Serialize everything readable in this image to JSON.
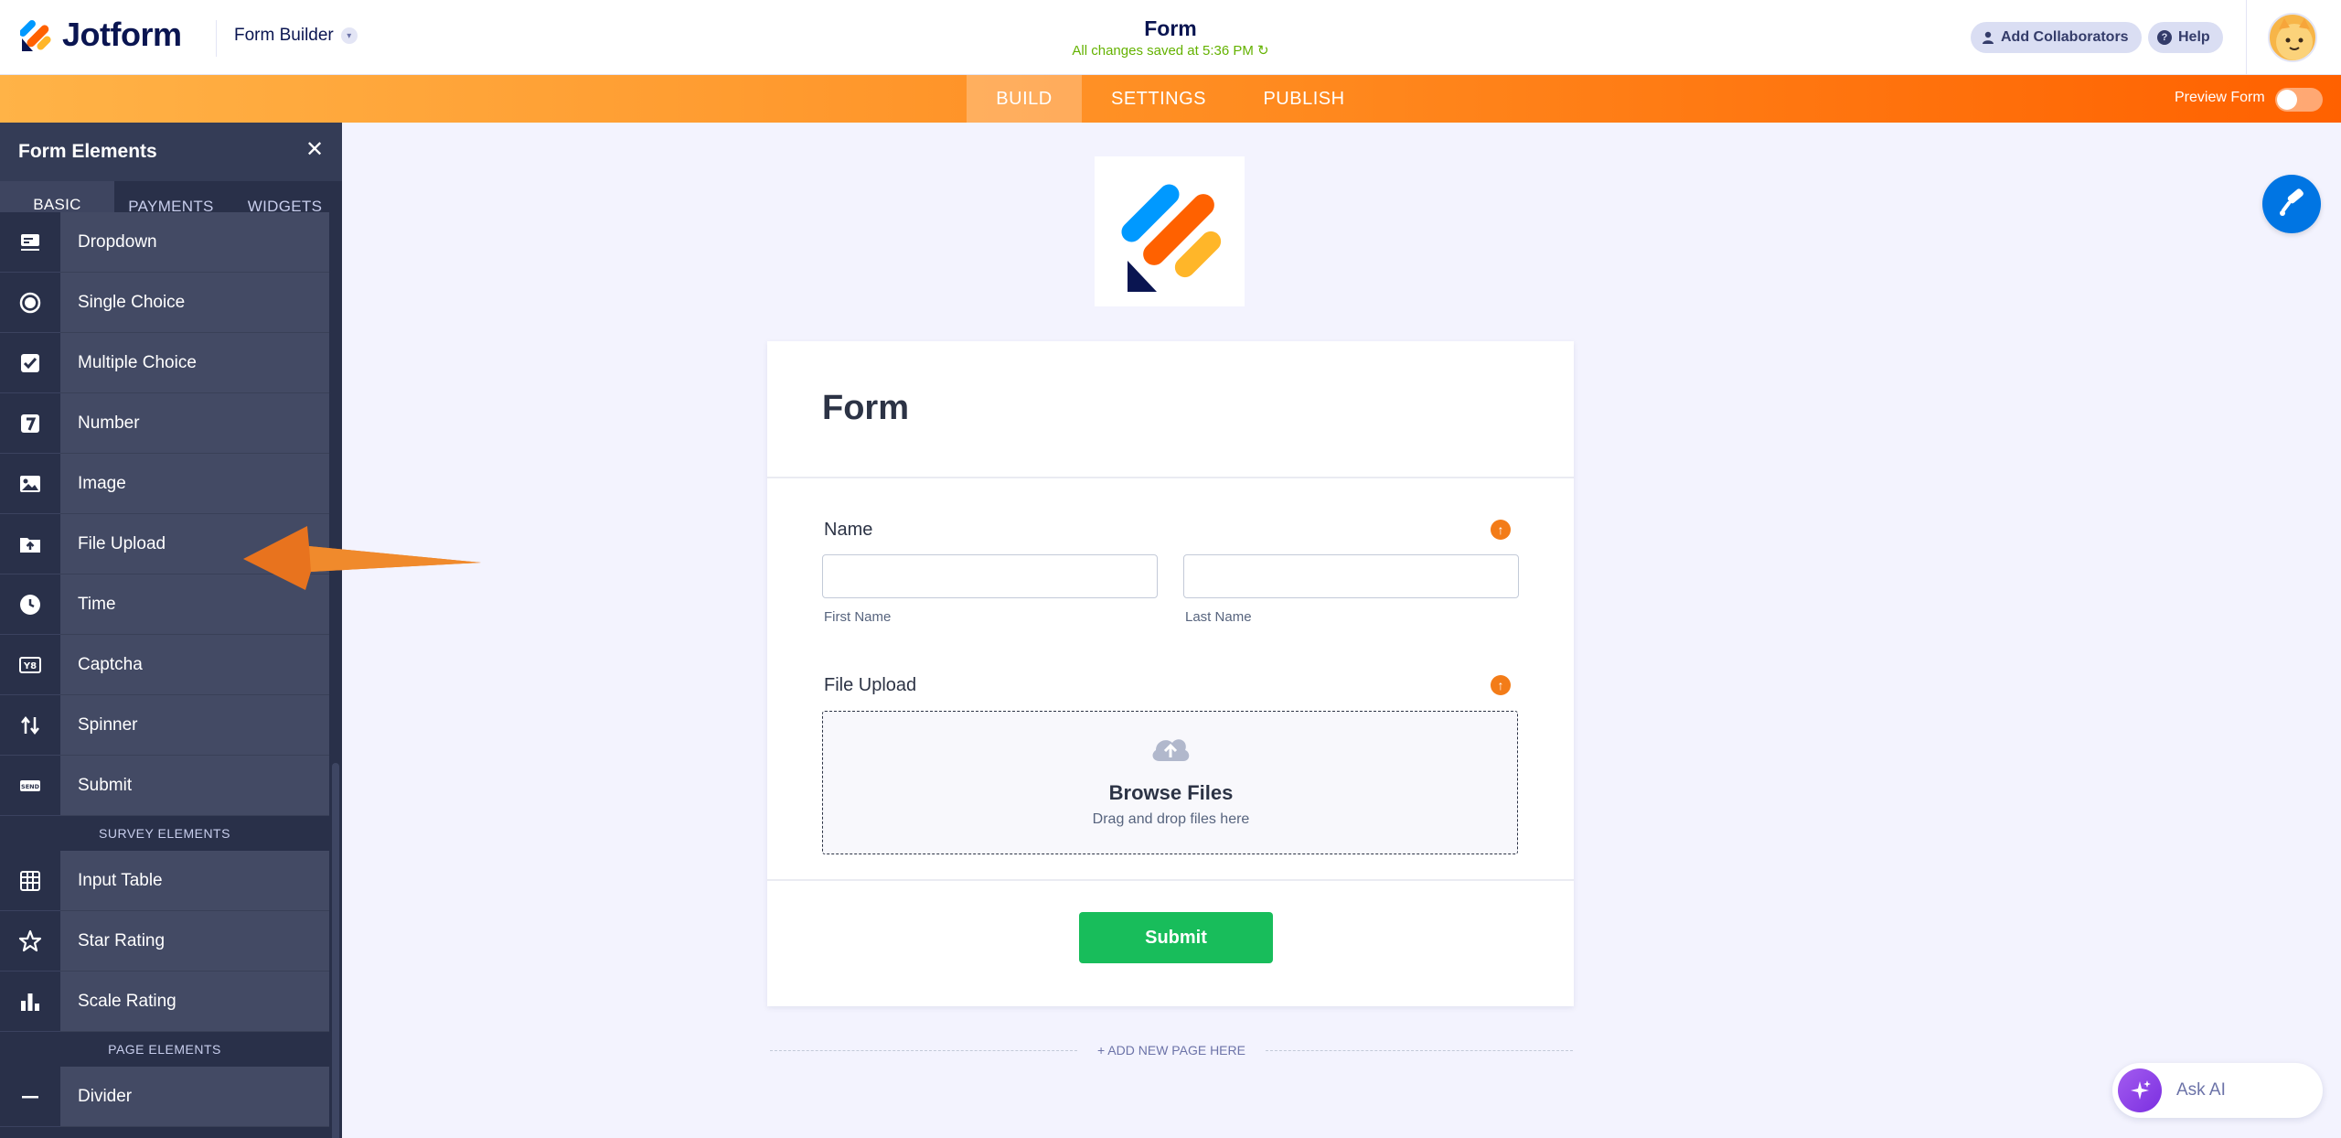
{
  "header": {
    "brand": "Jotform",
    "builder_menu": "Form Builder",
    "title": "Form",
    "saved_status": "All changes saved at 5:36 PM",
    "add_collaborators": "Add Collaborators",
    "help": "Help"
  },
  "nav": {
    "tabs": [
      {
        "label": "BUILD",
        "active": true
      },
      {
        "label": "SETTINGS",
        "active": false
      },
      {
        "label": "PUBLISH",
        "active": false
      }
    ],
    "preview_label": "Preview Form",
    "preview_enabled": false
  },
  "sidebar": {
    "title": "Form Elements",
    "tabs": [
      {
        "label": "BASIC",
        "active": true
      },
      {
        "label": "PAYMENTS",
        "active": false
      },
      {
        "label": "WIDGETS",
        "active": false
      }
    ],
    "basic_items": [
      {
        "label": "Dropdown",
        "icon": "dropdown-icon"
      },
      {
        "label": "Single Choice",
        "icon": "radio-icon"
      },
      {
        "label": "Multiple Choice",
        "icon": "checkbox-icon"
      },
      {
        "label": "Number",
        "icon": "number-icon"
      },
      {
        "label": "Image",
        "icon": "image-icon"
      },
      {
        "label": "File Upload",
        "icon": "file-upload-icon"
      },
      {
        "label": "Time",
        "icon": "clock-icon"
      },
      {
        "label": "Captcha",
        "icon": "captcha-icon"
      },
      {
        "label": "Spinner",
        "icon": "spinner-icon"
      },
      {
        "label": "Submit",
        "icon": "send-icon"
      }
    ],
    "survey_section": "SURVEY ELEMENTS",
    "survey_items": [
      {
        "label": "Input Table",
        "icon": "table-icon"
      },
      {
        "label": "Star Rating",
        "icon": "star-icon"
      },
      {
        "label": "Scale Rating",
        "icon": "bar-chart-icon"
      }
    ],
    "page_section": "PAGE ELEMENTS",
    "page_items": [
      {
        "label": "Divider",
        "icon": "divider-icon"
      }
    ]
  },
  "form": {
    "heading": "Form",
    "name_label": "Name",
    "first_name": "First Name",
    "last_name": "Last Name",
    "upload_label": "File Upload",
    "browse": "Browse Files",
    "drag_drop": "Drag and drop files here",
    "submit": "Submit",
    "add_page": "+ ADD NEW PAGE HERE"
  },
  "ask_ai": "Ask AI",
  "colors": {
    "accent_orange": "#ff6100",
    "submit_green": "#18bd5b",
    "sidebar_bg": "#293049",
    "brand_navy": "#0a1551"
  }
}
